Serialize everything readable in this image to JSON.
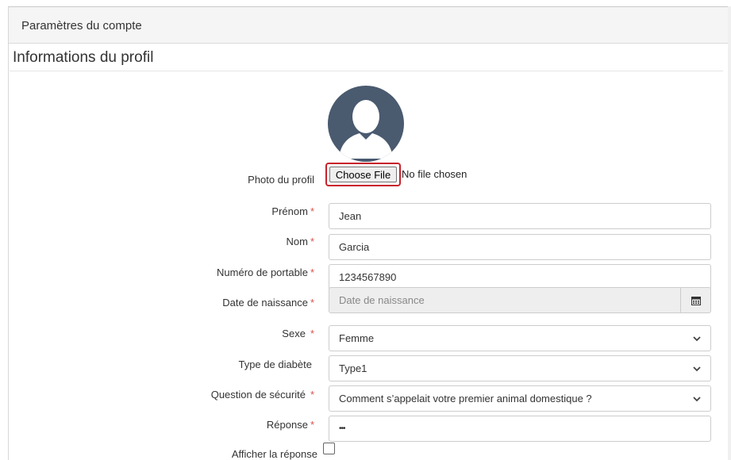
{
  "header": {
    "title": "Paramètres du compte"
  },
  "section": {
    "title": "Informations du profil"
  },
  "avatar": {
    "icon": "user-avatar-icon",
    "color": "#4a5a6f"
  },
  "photo": {
    "label": "Photo du profil",
    "button_label": "Choose File",
    "status": "No file chosen",
    "highlight_color": "#c8212a"
  },
  "fields": {
    "first_name": {
      "label": "Prénom",
      "required": "*",
      "value": "Jean"
    },
    "last_name": {
      "label": "Nom",
      "required": "*",
      "value": "Garcia"
    },
    "mobile": {
      "label": "Numéro de portable",
      "required": "*",
      "value": "1234567890"
    },
    "birth_date": {
      "label": "Date de naissance",
      "required": "*",
      "placeholder": "Date de naissance",
      "icon": "calendar-icon"
    },
    "gender": {
      "label": "Sexe",
      "required": "*",
      "value": "Femme"
    },
    "diabetes_type": {
      "label": "Type de diabète",
      "value": "Type1"
    },
    "security_question": {
      "label": "Question de sécurité",
      "required": "*",
      "value": "Comment s’appelait votre premier animal domestique ?"
    },
    "answer": {
      "label": "Réponse",
      "required": "*",
      "value": "•••"
    },
    "show_answer": {
      "label": "Afficher la réponse",
      "checked": false
    }
  },
  "colors": {
    "required": "#d9534f",
    "disabled_bg": "#eeeeee",
    "border": "#cccccc"
  }
}
